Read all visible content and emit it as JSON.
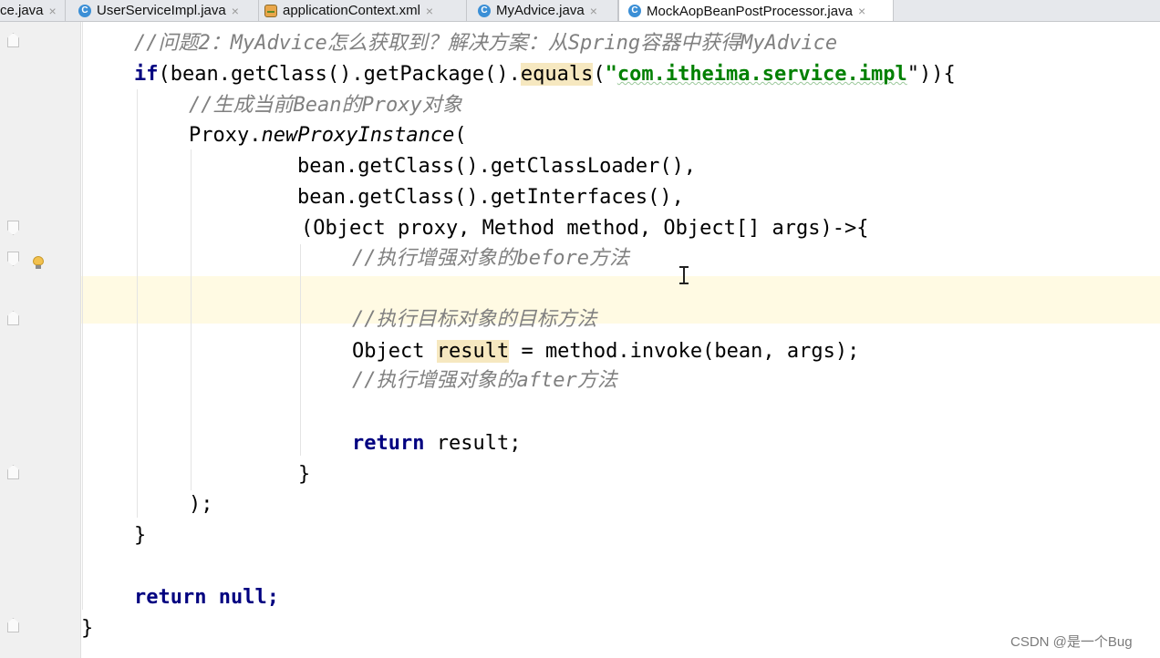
{
  "tabs": [
    {
      "label": "ce.java",
      "icon": "class-icon",
      "active": false
    },
    {
      "label": "UserServiceImpl.java",
      "icon": "class-icon",
      "active": false
    },
    {
      "label": "applicationContext.xml",
      "icon": "xml-file-icon",
      "active": false
    },
    {
      "label": "MyAdvice.java",
      "icon": "class-icon",
      "active": false
    },
    {
      "label": "MockAopBeanPostProcessor.java",
      "icon": "class-icon",
      "active": true
    }
  ],
  "tab_close_glyph": "×",
  "class_icon_letter": "C",
  "code": {
    "l1_comment": "//问题2：MyAdvice怎么获取到？解决方案：从Spring容器中获得MyAdvice",
    "l2_if": "if",
    "l2_a": "(bean.getClass().getPackage().",
    "l2_equals": "equals",
    "l2_paren": "(",
    "l2_q": "\"",
    "l2_str": "com.itheima.service.impl",
    "l2_end": "\")){",
    "l3_comment": "//生成当前Bean的Proxy对象",
    "l4_proxy": "Proxy.",
    "l4_method": "newProxyInstance",
    "l4_paren": "(",
    "l5": "bean.getClass().getClassLoader(),",
    "l6": "bean.getClass().getInterfaces(),",
    "l7": "(Object proxy, Method method, Object[] args)->{",
    "l8_comment": "//执行增强对象的before方法",
    "l9_comment": "//执行目标对象的目标方法",
    "l10_a": "Object ",
    "l10_result": "result",
    "l10_b": " = method.invoke(bean, args);",
    "l11_comment": "//执行增强对象的after方法",
    "l12_return": "return",
    "l12_rest": " result;",
    "l13": "}",
    "l14": ");",
    "l15": "}",
    "l16_return": "return",
    "l16_null": " null;",
    "l17": "}"
  },
  "watermark": "CSDN @是一个Bug",
  "colors": {
    "keyword": "#000080",
    "string": "#008000",
    "comment": "#808080",
    "caret_row": "#fffae3",
    "usage_highlight": "#f6e8c0"
  }
}
